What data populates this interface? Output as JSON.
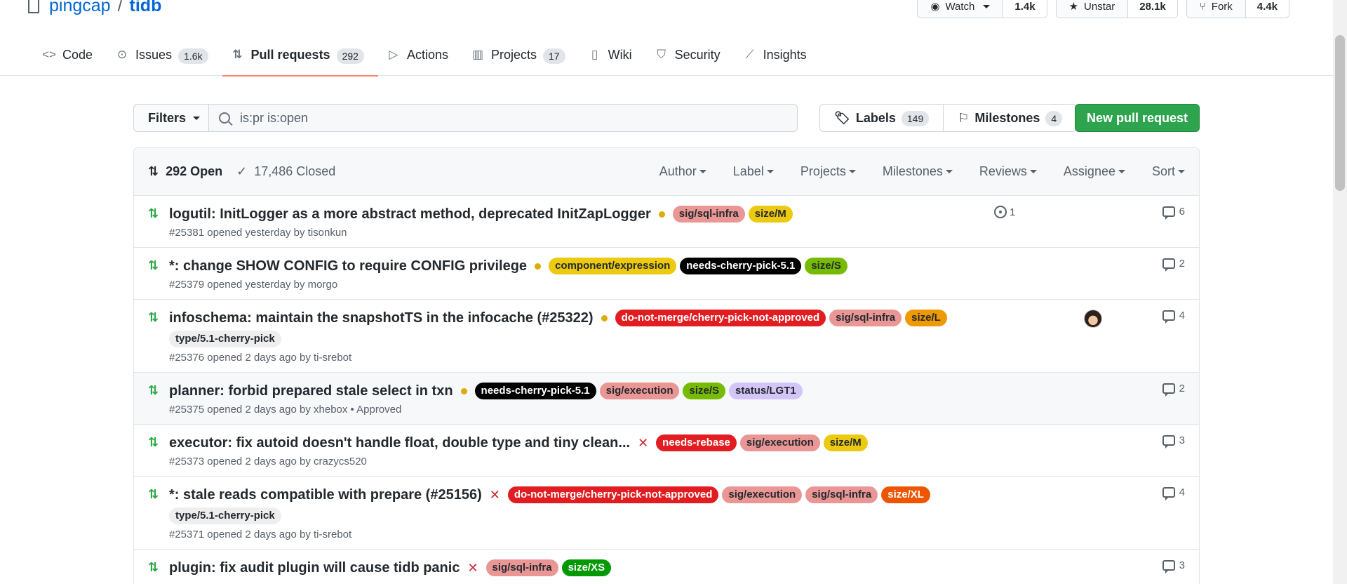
{
  "repo": {
    "owner": "pingcap",
    "sep": "/",
    "name": "tidb"
  },
  "actions": [
    {
      "icon": "eye-icon",
      "glyph": "◉",
      "label": "Watch",
      "count": "1.4k",
      "caret": true
    },
    {
      "icon": "star-icon",
      "glyph": "★",
      "label": "Unstar",
      "count": "28.1k",
      "caret": false
    },
    {
      "icon": "fork-icon",
      "glyph": "⑂",
      "label": "Fork",
      "count": "4.4k",
      "caret": false
    }
  ],
  "nav": [
    {
      "glyph": "<>",
      "label": "Code",
      "counter": ""
    },
    {
      "glyph": "⊙",
      "label": "Issues",
      "counter": "1.6k"
    },
    {
      "glyph": "⇅",
      "label": "Pull requests",
      "counter": "292",
      "selected": true
    },
    {
      "glyph": "▷",
      "label": "Actions",
      "counter": ""
    },
    {
      "glyph": "▥",
      "label": "Projects",
      "counter": "17"
    },
    {
      "glyph": "▯",
      "label": "Wiki",
      "counter": ""
    },
    {
      "glyph": "⛉",
      "label": "Security",
      "counter": ""
    },
    {
      "glyph": "⟋",
      "label": "Insights",
      "counter": ""
    }
  ],
  "subnav": {
    "filters_label": "Filters",
    "search_value": "is:pr is:open",
    "labels_label": "Labels",
    "labels_count": "149",
    "milestones_label": "Milestones",
    "milestones_count": "4",
    "new_pr_label": "New pull request"
  },
  "list_header": {
    "open_label": "292 Open",
    "closed_label": "17,486 Closed",
    "selects": [
      "Author",
      "Label",
      "Projects",
      "Milestones",
      "Reviews",
      "Assignee",
      "Sort"
    ]
  },
  "colors": {
    "accent": "#2ea44f",
    "link": "#0366d6",
    "tab_underline": "#f9826c"
  },
  "prs": [
    {
      "title": "logutil: InitLogger as a more abstract method, deprecated InitZapLogger",
      "status": "pending",
      "labels": [
        {
          "text": "sig/sql-infra",
          "bg": "#e99695",
          "fg": "#24292e"
        },
        {
          "text": "size/M",
          "bg": "#ebca0f",
          "fg": "#24292e"
        }
      ],
      "meta": "#25381 opened yesterday by tisonkun",
      "linked": "1",
      "avatar": false,
      "comments": "6",
      "highlight": false
    },
    {
      "title": "*: change SHOW CONFIG to require CONFIG privilege",
      "status": "pending",
      "labels": [
        {
          "text": "component/expression",
          "bg": "#ebca0f",
          "fg": "#24292e"
        },
        {
          "text": "needs-cherry-pick-5.1",
          "bg": "#000000",
          "fg": "#ffffff"
        },
        {
          "text": "size/S",
          "bg": "#77bb00",
          "fg": "#24292e"
        }
      ],
      "meta": "#25379 opened yesterday by morgo",
      "linked": "",
      "avatar": false,
      "comments": "2",
      "highlight": false
    },
    {
      "title": "infoschema: maintain the snapshotTS in the infocache (#25322)",
      "status": "pending",
      "labels": [
        {
          "text": "do-not-merge/cherry-pick-not-approved",
          "bg": "#e11d21",
          "fg": "#ffffff"
        },
        {
          "text": "sig/sql-infra",
          "bg": "#e99695",
          "fg": "#24292e"
        },
        {
          "text": "size/L",
          "bg": "#ee9900",
          "fg": "#24292e"
        },
        {
          "text": "type/5.1-cherry-pick",
          "bg": "#eeeeee",
          "fg": "#24292e"
        }
      ],
      "meta": "#25376 opened 2 days ago by ti-srebot",
      "linked": "",
      "avatar": true,
      "comments": "4",
      "highlight": false
    },
    {
      "title": "planner: forbid prepared stale select in txn",
      "status": "pending",
      "labels": [
        {
          "text": "needs-cherry-pick-5.1",
          "bg": "#000000",
          "fg": "#ffffff"
        },
        {
          "text": "sig/execution",
          "bg": "#e99695",
          "fg": "#24292e"
        },
        {
          "text": "size/S",
          "bg": "#77bb00",
          "fg": "#24292e"
        },
        {
          "text": "status/LGT1",
          "bg": "#d4c5f9",
          "fg": "#24292e"
        }
      ],
      "meta": "#25375 opened 2 days ago by xhebox • Approved",
      "linked": "",
      "avatar": false,
      "comments": "2",
      "highlight": true
    },
    {
      "title": "executor: fix autoid doesn't handle float, double type and tiny clean...",
      "status": "failed",
      "labels": [
        {
          "text": "needs-rebase",
          "bg": "#e11d21",
          "fg": "#ffffff"
        },
        {
          "text": "sig/execution",
          "bg": "#e99695",
          "fg": "#24292e"
        },
        {
          "text": "size/M",
          "bg": "#ebca0f",
          "fg": "#24292e"
        }
      ],
      "meta": "#25373 opened 2 days ago by crazycs520",
      "linked": "",
      "avatar": false,
      "comments": "3",
      "highlight": false
    },
    {
      "title": "*: stale reads compatible with prepare (#25156)",
      "status": "failed",
      "labels": [
        {
          "text": "do-not-merge/cherry-pick-not-approved",
          "bg": "#e11d21",
          "fg": "#ffffff"
        },
        {
          "text": "sig/execution",
          "bg": "#e99695",
          "fg": "#24292e"
        },
        {
          "text": "sig/sql-infra",
          "bg": "#e99695",
          "fg": "#24292e"
        },
        {
          "text": "size/XL",
          "bg": "#ee5500",
          "fg": "#ffffff"
        },
        {
          "text": "type/5.1-cherry-pick",
          "bg": "#eeeeee",
          "fg": "#24292e"
        }
      ],
      "meta": "#25371 opened 2 days ago by ti-srebot",
      "linked": "",
      "avatar": false,
      "comments": "4",
      "highlight": false
    },
    {
      "title": "plugin: fix audit plugin will cause tidb panic",
      "status": "failed",
      "labels": [
        {
          "text": "sig/sql-infra",
          "bg": "#e99695",
          "fg": "#24292e"
        },
        {
          "text": "size/XS",
          "bg": "#009900",
          "fg": "#ffffff"
        }
      ],
      "meta": "",
      "linked": "",
      "avatar": false,
      "comments": "3",
      "highlight": false
    }
  ]
}
